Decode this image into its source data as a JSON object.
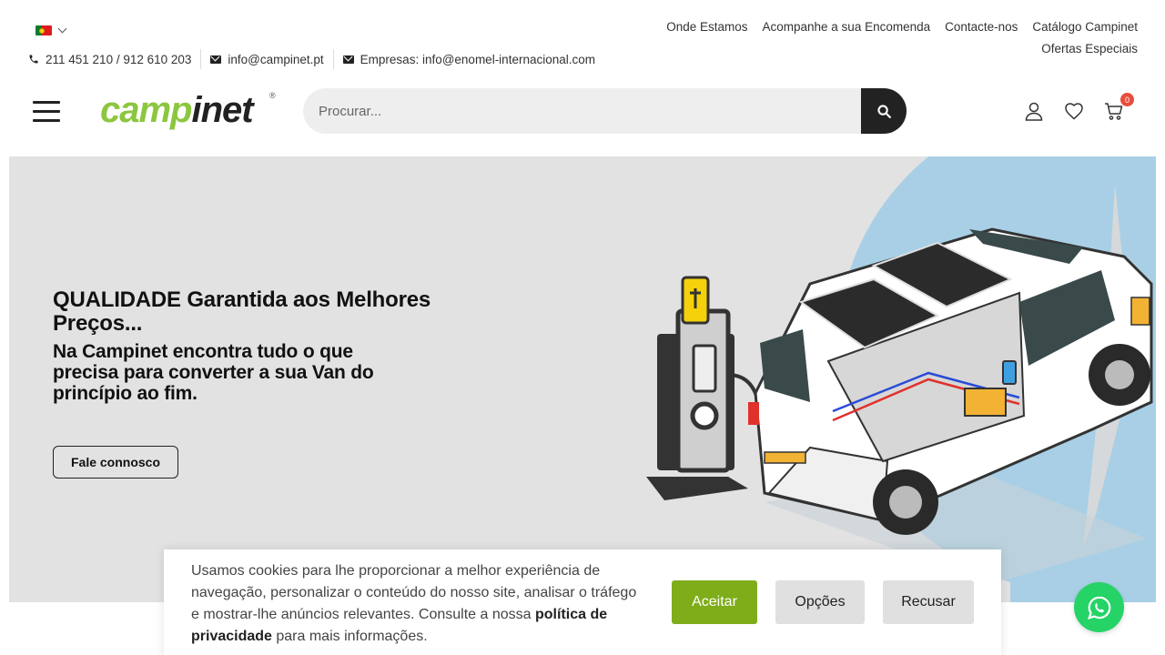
{
  "colors": {
    "brand_green": "#8cc63f",
    "accent_dark": "#222222",
    "accept_green": "#7fad1a",
    "whatsapp_green": "#25d366",
    "cart_badge": "#e74c3c"
  },
  "topbar": {
    "language_icon": "portugal-flag-icon",
    "phone": "211 451 210 / 912 610 203",
    "email": "info@campinet.pt",
    "business_email": "Empresas: info@enomel-internacional.com",
    "links": [
      "Onde Estamos",
      "Acompanhe a sua Encomenda",
      "Contacte-nos",
      "Catálogo Campinet"
    ],
    "special_offers": "Ofertas Especiais"
  },
  "header": {
    "logo_text": "campinet",
    "logo_mark": "®",
    "search_placeholder": "Procurar...",
    "cart_count": "0"
  },
  "hero": {
    "title": "QUALIDADE Garantida aos Melhores Preços...",
    "subtitle": "Na Campinet encontra tudo o que precisa para converter a sua Van do princípio ao fim.",
    "button": "Fale connosco"
  },
  "cookie": {
    "text_before": "Usamos cookies para lhe proporcionar a melhor experiência de navegação, personalizar o conteúdo do nosso site, analisar o tráfego e mostrar-lhe anúncios relevantes. Consulte a nossa ",
    "link": "política de privacidade",
    "text_after": " para mais informações.",
    "accept": "Aceitar",
    "options": "Opções",
    "refuse": "Recusar"
  }
}
